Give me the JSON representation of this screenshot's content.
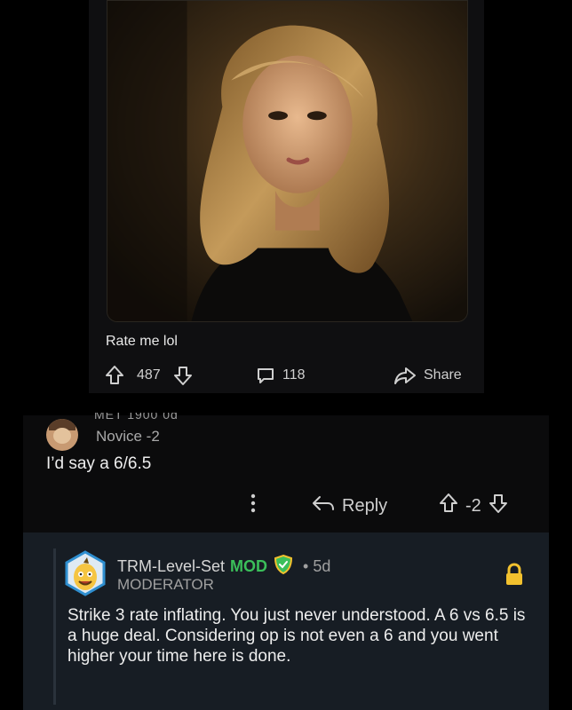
{
  "post": {
    "title": "Rate me lol",
    "upvotes": "487",
    "comments": "118",
    "share_label": "Share"
  },
  "comment": {
    "username_cut": "MET 1900 0d",
    "flair": "Novice -2",
    "body": "I’d say a 6/6.5",
    "reply_label": "Reply",
    "score": "-2"
  },
  "mod_reply": {
    "username": "TRM-Level-Set",
    "mod_tag": "MOD",
    "age": "• 5d",
    "role": "MODERATOR",
    "body": "Strike 3 rate inflating.  You just never understood. A 6 vs 6.5 is a huge deal.  Considering op is not even a 6 and you went higher your time here is done."
  },
  "colors": {
    "mod_green": "#3bbf5a",
    "lock_yellow": "#f2c12e",
    "reply_bg": "#171d24"
  },
  "icons": [
    "upvote-icon",
    "downvote-icon",
    "comment-icon",
    "share-icon",
    "more-icon",
    "reply-icon",
    "shield-icon",
    "lock-icon"
  ]
}
